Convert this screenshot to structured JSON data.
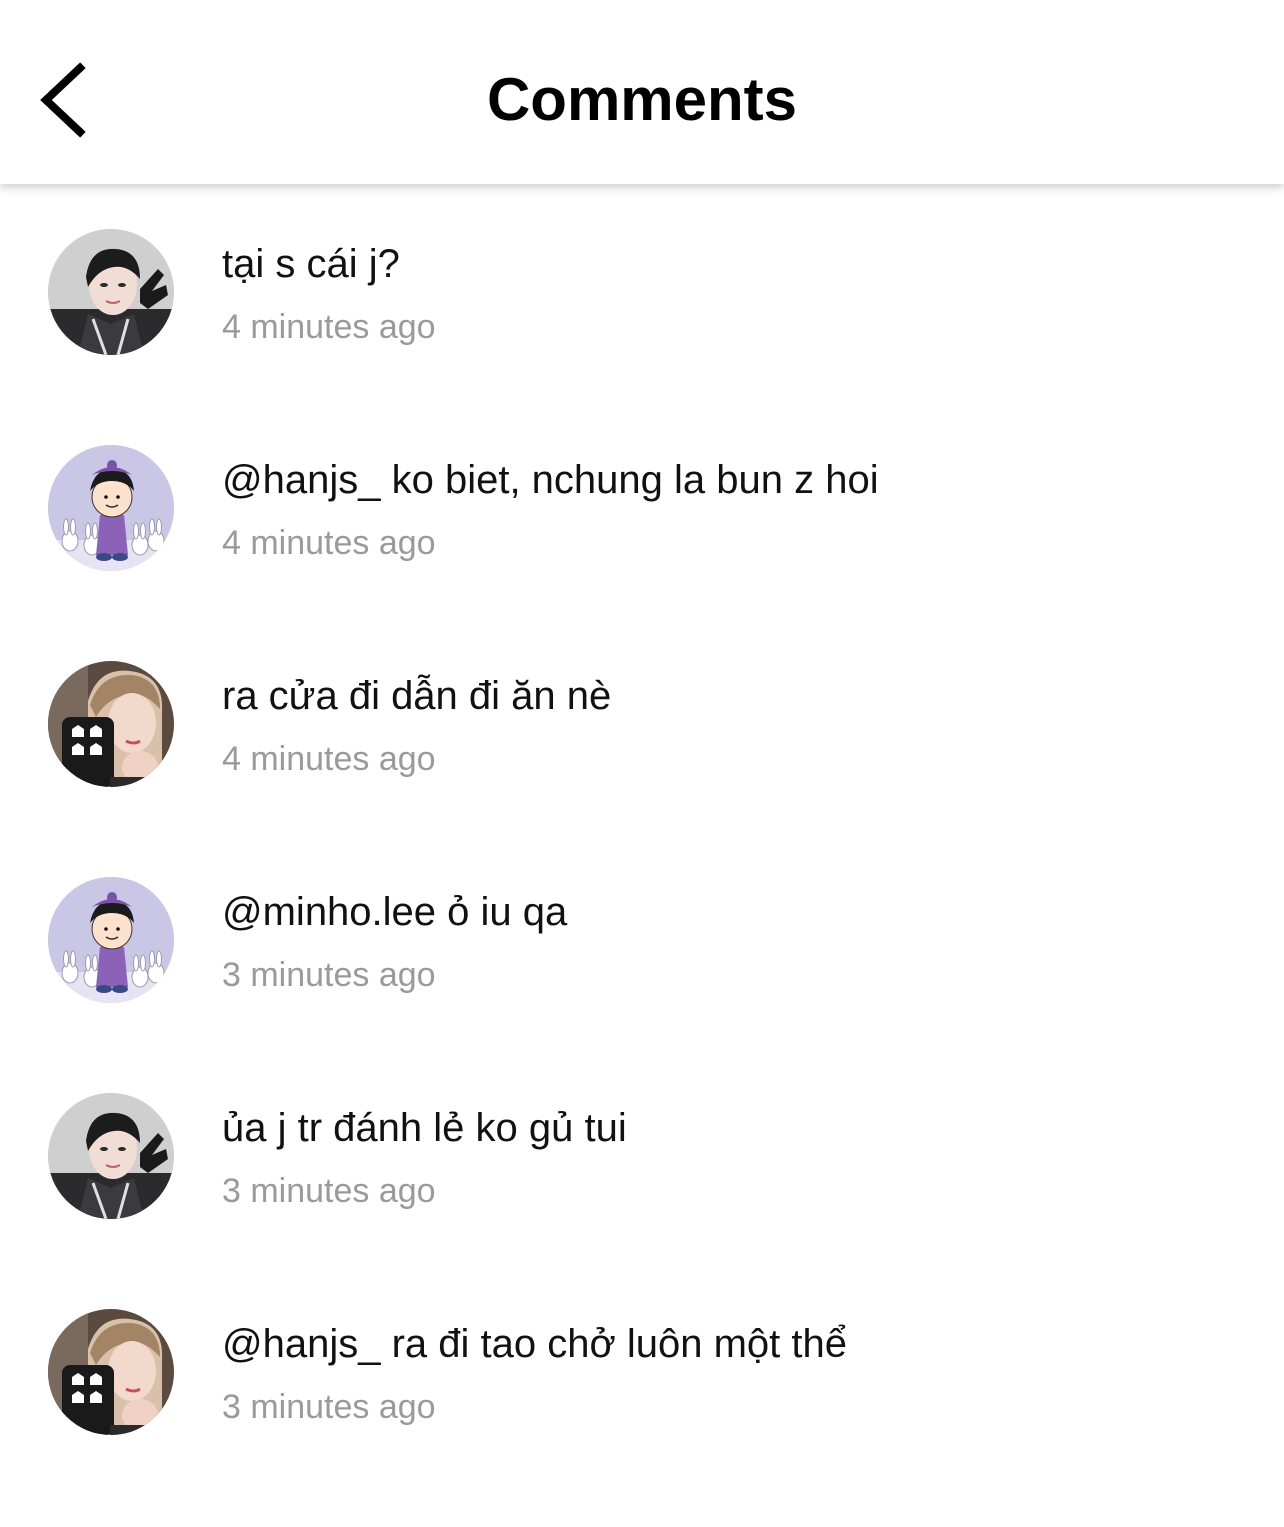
{
  "header": {
    "title": "Comments",
    "back_icon": "chevron-left-icon"
  },
  "colors": {
    "background": "#ffffff",
    "text": "#111111",
    "timestamp": "#9a9a9a"
  },
  "comments": [
    {
      "avatar": "avatar-boy-gloves",
      "text": "tại s cái j?",
      "time": "4 minutes ago"
    },
    {
      "avatar": "avatar-cartoon-girl",
      "text": "@hanjs_ ko biet, nchung la bun z hoi",
      "time": "4 minutes ago"
    },
    {
      "avatar": "avatar-boy-phone",
      "text": "ra cửa đi dẫn đi ăn nè",
      "time": "4 minutes ago"
    },
    {
      "avatar": "avatar-cartoon-girl",
      "text": "@minho.lee ỏ iu qa",
      "time": "3 minutes ago"
    },
    {
      "avatar": "avatar-boy-gloves",
      "text": "ủa j tr đánh lẻ ko gủ tui",
      "time": "3 minutes ago"
    },
    {
      "avatar": "avatar-boy-phone",
      "text": "@hanjs_ ra đi tao chở luôn một thể",
      "time": "3 minutes ago"
    }
  ]
}
